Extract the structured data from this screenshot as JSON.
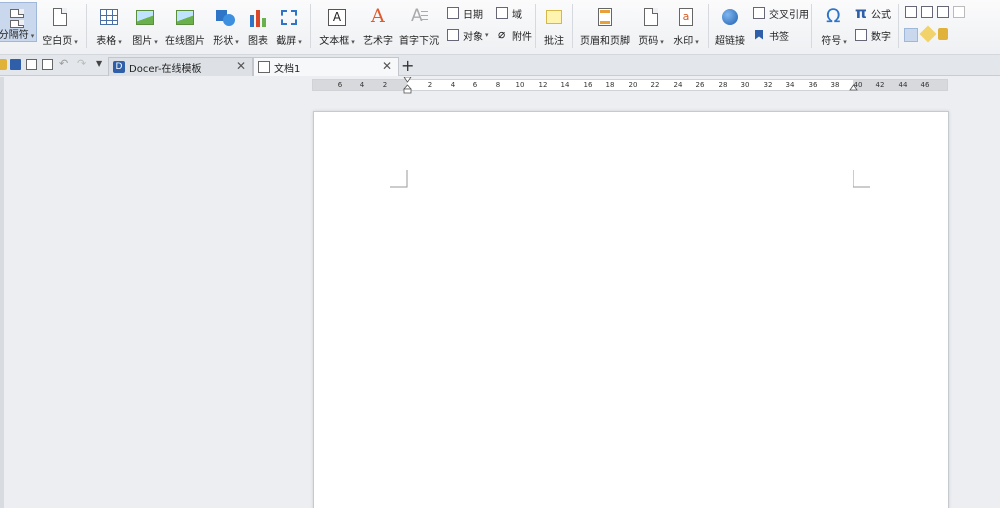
{
  "ribbon": {
    "page_break": "分隔符",
    "blank_page": "空白页",
    "table": "表格",
    "picture": "图片",
    "online_picture": "在线图片",
    "shapes": "形状",
    "chart": "图表",
    "screenshot": "截屏",
    "text_box": "文本框",
    "word_art": "艺术字",
    "drop_cap": "首字下沉",
    "date": "日期",
    "object": "对象",
    "field": "域",
    "attachment": "附件",
    "comment": "批注",
    "header_footer": "页眉和页脚",
    "page_number": "页码",
    "watermark": "水印",
    "hyperlink": "超链接",
    "cross_reference": "交叉引用",
    "bookmark": "书签",
    "symbol": "符号",
    "formula": "公式",
    "number": "数字"
  },
  "tabs": [
    {
      "label": "Docer-在线模板",
      "icon": "docer-icon"
    },
    {
      "label": "文档1",
      "icon": "document-icon"
    }
  ],
  "ruler": {
    "left_ticks": [
      "6",
      "4",
      "2"
    ],
    "right_ticks": [
      "2",
      "4",
      "6",
      "8",
      "10",
      "12",
      "14",
      "16",
      "18",
      "20",
      "22",
      "24",
      "26",
      "28",
      "30",
      "32",
      "34",
      "36",
      "38",
      "40",
      "42",
      "44",
      "46"
    ]
  },
  "colors": {
    "accent": "#2e75c8",
    "ribbon_bg": "#f3f4f6",
    "workspace_bg": "#eceef1"
  }
}
